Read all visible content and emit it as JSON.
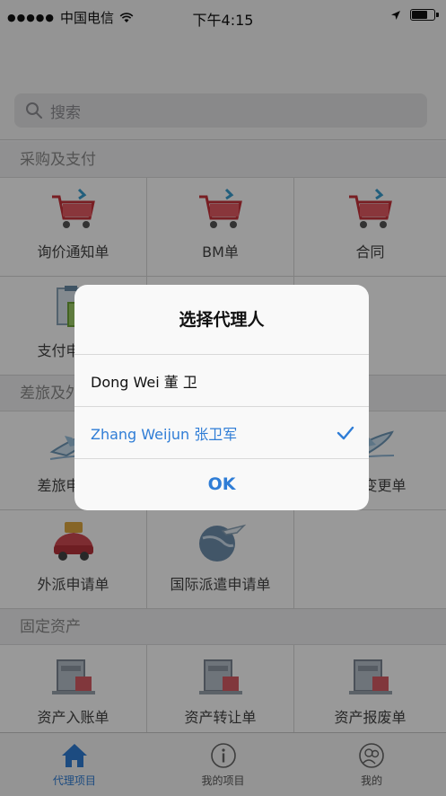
{
  "status_bar": {
    "signal": "●●●●●",
    "carrier": "中国电信",
    "time": "下午4:15",
    "icons": [
      "wifi-icon",
      "location-arrow-icon",
      "battery-icon"
    ]
  },
  "search": {
    "placeholder": "搜索",
    "icon": "search-icon"
  },
  "sections": [
    {
      "title": "采购及支付",
      "items": [
        {
          "label": "询价通知单",
          "icon": "shopping-cart-icon"
        },
        {
          "label": "BM单",
          "icon": "shopping-cart-icon"
        },
        {
          "label": "合同",
          "icon": "shopping-cart-icon"
        },
        {
          "label": "支付申请单",
          "icon": "payment-document-icon"
        }
      ]
    },
    {
      "title": "差旅及外派",
      "items": [
        {
          "label": "差旅申请单",
          "icon": "airplane-icon"
        },
        {
          "label": "差旅变更单",
          "icon": "airplane-icon"
        },
        {
          "label": "外派申请单",
          "icon": "car-icon"
        },
        {
          "label": "国际派遣申请单",
          "icon": "globe-plane-icon"
        }
      ]
    },
    {
      "title": "固定资产",
      "items": [
        {
          "label": "资产入账单",
          "icon": "asset-icon"
        },
        {
          "label": "资产转让单",
          "icon": "asset-icon"
        },
        {
          "label": "资产报废单",
          "icon": "asset-icon"
        }
      ]
    }
  ],
  "tabs": [
    {
      "label": "代理项目",
      "icon": "home-icon",
      "active": true
    },
    {
      "label": "我的项目",
      "icon": "info-icon",
      "active": false
    },
    {
      "label": "我的",
      "icon": "users-icon",
      "active": false
    }
  ],
  "dialog": {
    "title": "选择代理人",
    "options": [
      {
        "label": "Dong Wei 董 卫",
        "selected": false
      },
      {
        "label": "Zhang Weijun 张卫军",
        "selected": true
      }
    ],
    "ok_label": "OK"
  },
  "colors": {
    "accent": "#2f7dd6",
    "overlay": "rgba(0,0,0,0.40)"
  }
}
